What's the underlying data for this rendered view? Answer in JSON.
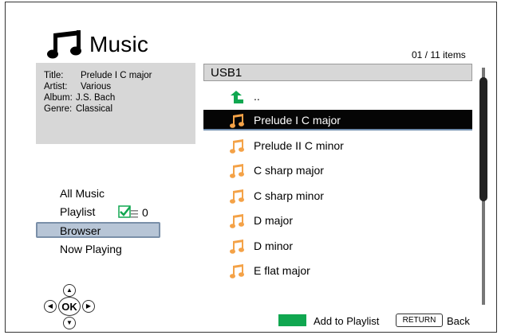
{
  "header": {
    "title": "Music",
    "icon": "music-note-icon"
  },
  "item_count": "01 / 11 items",
  "info": {
    "title_label": "Title:",
    "title_value": "Prelude I C major",
    "artist_label": "Artist:",
    "artist_value": "Various",
    "album_label": "Album:",
    "album_value": "J.S. Bach",
    "genre_label": "Genre:",
    "genre_value": "Classical"
  },
  "nav": {
    "items": [
      {
        "label": "All Music"
      },
      {
        "label": "Playlist"
      },
      {
        "label": "Browser",
        "selected": true
      },
      {
        "label": "Now Playing"
      }
    ],
    "playlist_count": "0"
  },
  "dpad": {
    "ok_label": "OK"
  },
  "browser": {
    "location": "USB1",
    "up_label": "..",
    "files": [
      {
        "label": "Prelude I C major",
        "selected": true
      },
      {
        "label": "Prelude II C minor"
      },
      {
        "label": "C sharp major"
      },
      {
        "label": "C sharp minor"
      },
      {
        "label": "D major"
      },
      {
        "label": "D minor"
      },
      {
        "label": "E flat major"
      }
    ]
  },
  "footer": {
    "add_label": "Add to Playlist",
    "return_key": "RETURN",
    "back_label": "Back"
  },
  "colors": {
    "accent_green": "#10a750",
    "note_orange": "#f4a247",
    "selection_bg": "#050505",
    "panel_gray": "#d7d7d7"
  }
}
